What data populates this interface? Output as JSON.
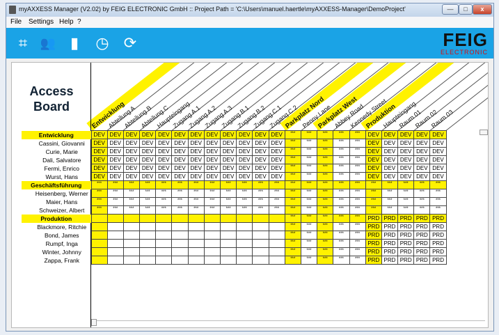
{
  "window": {
    "title": "myAXXESS Manager (V2.02) by FEIG ELECTRONIC GmbH :: Project Path = 'C:\\Users\\manuel.haertle\\myAXXESS-Manager\\DemoProject'",
    "min_label": "—",
    "max_label": "□",
    "close_label": "x"
  },
  "menu": [
    "File",
    "Settings",
    "Help",
    "?"
  ],
  "toolbar": {
    "icons": [
      "reader-scan-icon",
      "users-icon",
      "doors-icon",
      "clock-icon",
      "sync-icon"
    ],
    "glyphs": [
      "⌗",
      "👥",
      "▮",
      "◷",
      "⟳"
    ]
  },
  "logo": {
    "line1": "FEIG",
    "line2": "ELECTRONIC"
  },
  "board": {
    "title_line1": "Access",
    "title_line2": "Board"
  },
  "colors": {
    "accent": "#1aa3e6",
    "highlight": "#fff200",
    "brand_red": "#d41010"
  },
  "columns": [
    {
      "label": "Entwicklung",
      "group": true
    },
    {
      "label": "Abteilung A",
      "group": false
    },
    {
      "label": "Abteilung B",
      "group": false
    },
    {
      "label": "Abteilung C",
      "group": false
    },
    {
      "label": "Haupteingang",
      "group": false
    },
    {
      "label": "Zugang A.1",
      "group": false
    },
    {
      "label": "Zugang A.2",
      "group": false
    },
    {
      "label": "Zugang A.3",
      "group": false
    },
    {
      "label": "Zugang B.1",
      "group": false
    },
    {
      "label": "Zugang B.2",
      "group": false
    },
    {
      "label": "Zugang C.1",
      "group": false
    },
    {
      "label": "Zugang C.2",
      "group": false
    },
    {
      "label": "Parkplatz Nord",
      "group": true
    },
    {
      "label": "Penny Lane",
      "group": false
    },
    {
      "label": "Parkplatz West",
      "group": true
    },
    {
      "label": "Abbey Road",
      "group": false
    },
    {
      "label": "Kennedy Street",
      "group": false
    },
    {
      "label": "Produktion",
      "group": true
    },
    {
      "label": "Haupteingang",
      "group": false
    },
    {
      "label": "Raum 01",
      "group": false
    },
    {
      "label": "Raum 02",
      "group": false
    },
    {
      "label": "Raum 03",
      "group": false
    }
  ],
  "rows": [
    {
      "label": "Entwicklung",
      "group": true,
      "cells": [
        "DEV",
        "DEV",
        "DEV",
        "DEV",
        "DEV",
        "DEV",
        "DEV",
        "DEV",
        "DEV",
        "DEV",
        "DEV",
        "DEV",
        "***",
        "***",
        "***",
        "***",
        "***",
        "DEV",
        "DEV",
        "DEV",
        "DEV",
        "DEV"
      ]
    },
    {
      "label": "Cassini, Giovanni",
      "group": false,
      "cells": [
        "DEV",
        "DEV",
        "DEV",
        "DEV",
        "DEV",
        "DEV",
        "DEV",
        "DEV",
        "DEV",
        "DEV",
        "DEV",
        "DEV",
        "***",
        "***",
        "***",
        "***",
        "***",
        "DEV",
        "DEV",
        "DEV",
        "DEV",
        "DEV"
      ]
    },
    {
      "label": "Curie, Marie",
      "group": false,
      "cells": [
        "DEV",
        "DEV",
        "DEV",
        "DEV",
        "DEV",
        "DEV",
        "DEV",
        "DEV",
        "DEV",
        "DEV",
        "DEV",
        "DEV",
        "***",
        "***",
        "***",
        "***",
        "***",
        "DEV",
        "DEV",
        "DEV",
        "DEV",
        "DEV"
      ]
    },
    {
      "label": "Dali, Salvatore",
      "group": false,
      "cells": [
        "DEV",
        "DEV",
        "DEV",
        "DEV",
        "DEV",
        "DEV",
        "DEV",
        "DEV",
        "DEV",
        "DEV",
        "DEV",
        "DEV",
        "***",
        "***",
        "***",
        "***",
        "***",
        "DEV",
        "DEV",
        "DEV",
        "DEV",
        "DEV"
      ]
    },
    {
      "label": "Fermi, Enrico",
      "group": false,
      "cells": [
        "DEV",
        "DEV",
        "DEV",
        "DEV",
        "DEV",
        "DEV",
        "DEV",
        "DEV",
        "DEV",
        "DEV",
        "DEV",
        "DEV",
        "***",
        "***",
        "***",
        "***",
        "***",
        "DEV",
        "DEV",
        "DEV",
        "DEV",
        "DEV"
      ]
    },
    {
      "label": "Wurst, Hans",
      "group": false,
      "cells": [
        "DEV",
        "DEV",
        "DEV",
        "DEV",
        "DEV",
        "DEV",
        "DEV",
        "DEV",
        "DEV",
        "DEV",
        "DEV",
        "DEV",
        "***",
        "***",
        "***",
        "***",
        "***",
        "DEV",
        "DEV",
        "DEV",
        "DEV",
        "DEV"
      ]
    },
    {
      "label": "Geschäftsführung",
      "group": true,
      "cells": [
        "***",
        "***",
        "***",
        "***",
        "***",
        "***",
        "***",
        "***",
        "***",
        "***",
        "***",
        "***",
        "***",
        "***",
        "***",
        "***",
        "***",
        "***",
        "***",
        "***",
        "***",
        "***"
      ]
    },
    {
      "label": "Heisenberg, Werner",
      "group": false,
      "cells": [
        "***",
        "***",
        "***",
        "***",
        "***",
        "***",
        "***",
        "***",
        "***",
        "***",
        "***",
        "***",
        "***",
        "***",
        "***",
        "***",
        "***",
        "***",
        "***",
        "***",
        "***",
        "***"
      ]
    },
    {
      "label": "Maier, Hans",
      "group": false,
      "cells": [
        "***",
        "***",
        "***",
        "***",
        "***",
        "***",
        "***",
        "***",
        "***",
        "***",
        "***",
        "***",
        "***",
        "***",
        "***",
        "***",
        "***",
        "***",
        "***",
        "***",
        "***",
        "***"
      ]
    },
    {
      "label": "Schweizer, Albert",
      "group": false,
      "cells": [
        "***",
        "***",
        "***",
        "***",
        "***",
        "***",
        "***",
        "***",
        "***",
        "***",
        "***",
        "***",
        "***",
        "***",
        "***",
        "***",
        "***",
        "***",
        "***",
        "***",
        "***",
        "***"
      ]
    },
    {
      "label": "Produktion",
      "group": true,
      "cells": [
        "",
        "",
        "",
        "",
        "",
        "",
        "",
        "",
        "",
        "",
        "",
        "",
        "***",
        "***",
        "***",
        "***",
        "***",
        "PRD",
        "PRD",
        "PRD",
        "PRD",
        "PRD"
      ]
    },
    {
      "label": "Blackmore, Ritchie",
      "group": false,
      "cells": [
        "",
        "",
        "",
        "",
        "",
        "",
        "",
        "",
        "",
        "",
        "",
        "",
        "***",
        "***",
        "***",
        "***",
        "***",
        "PRD",
        "PRD",
        "PRD",
        "PRD",
        "PRD"
      ]
    },
    {
      "label": "Bond, James",
      "group": false,
      "cells": [
        "",
        "",
        "",
        "",
        "",
        "",
        "",
        "",
        "",
        "",
        "",
        "",
        "***",
        "***",
        "***",
        "***",
        "***",
        "PRD",
        "PRD",
        "PRD",
        "PRD",
        "PRD"
      ]
    },
    {
      "label": "Rumpf, Inga",
      "group": false,
      "cells": [
        "",
        "",
        "",
        "",
        "",
        "",
        "",
        "",
        "",
        "",
        "",
        "",
        "***",
        "***",
        "***",
        "***",
        "***",
        "PRD",
        "PRD",
        "PRD",
        "PRD",
        "PRD"
      ]
    },
    {
      "label": "Winter, Johnny",
      "group": false,
      "cells": [
        "",
        "",
        "",
        "",
        "",
        "",
        "",
        "",
        "",
        "",
        "",
        "",
        "***",
        "***",
        "***",
        "***",
        "***",
        "PRD",
        "PRD",
        "PRD",
        "PRD",
        "PRD"
      ]
    },
    {
      "label": "Zappa, Frank",
      "group": false,
      "cells": [
        "",
        "",
        "",
        "",
        "",
        "",
        "",
        "",
        "",
        "",
        "",
        "",
        "***",
        "***",
        "***",
        "***",
        "***",
        "PRD",
        "PRD",
        "PRD",
        "PRD",
        "PRD"
      ]
    }
  ]
}
